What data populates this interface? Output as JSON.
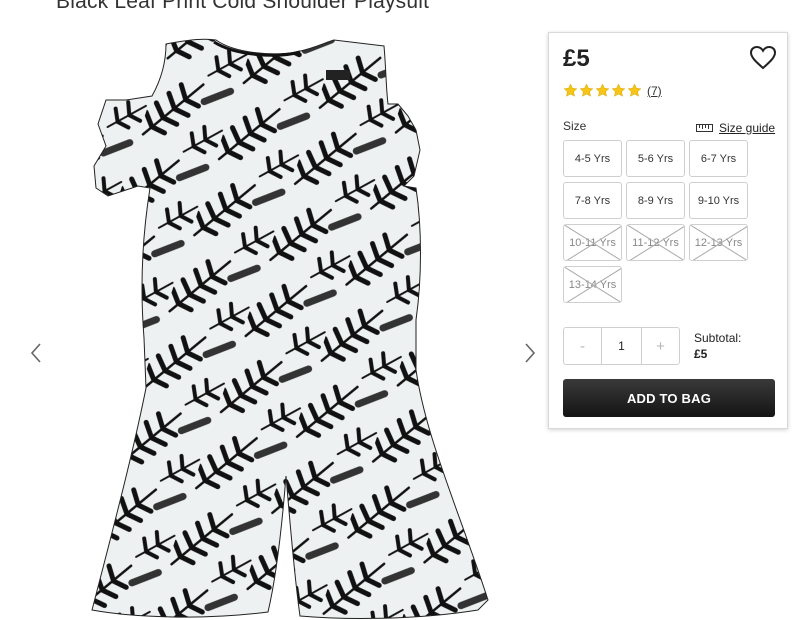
{
  "product": {
    "title": "Black Leaf Print Cold Shoulder Playsuit",
    "price": "£5",
    "rating_stars": 5,
    "review_count": "(7)"
  },
  "sizes": {
    "label": "Size",
    "guide_label": "Size guide",
    "options": [
      {
        "label": "4-5 Yrs",
        "available": true
      },
      {
        "label": "5-6 Yrs",
        "available": true
      },
      {
        "label": "6-7 Yrs",
        "available": true
      },
      {
        "label": "7-8 Yrs",
        "available": true
      },
      {
        "label": "8-9 Yrs",
        "available": true
      },
      {
        "label": "9-10 Yrs",
        "available": true
      },
      {
        "label": "10-11 Yrs",
        "available": false
      },
      {
        "label": "11-12 Yrs",
        "available": false
      },
      {
        "label": "12-13 Yrs",
        "available": false
      },
      {
        "label": "13-14 Yrs",
        "available": false
      }
    ]
  },
  "quantity": {
    "minus": "-",
    "value": "1",
    "plus": "+"
  },
  "subtotal": {
    "label": "Subtotal:",
    "value": "£5"
  },
  "add_to_bag_label": "ADD TO BAG",
  "icons": {
    "prev": "chevron-left-icon",
    "next": "chevron-right-icon",
    "wishlist": "heart-icon",
    "star": "star-icon",
    "ruler": "ruler-icon"
  },
  "colors": {
    "star": "#f5c518",
    "button": "#1e1e1e",
    "panel_border": "#d9d9d9"
  }
}
